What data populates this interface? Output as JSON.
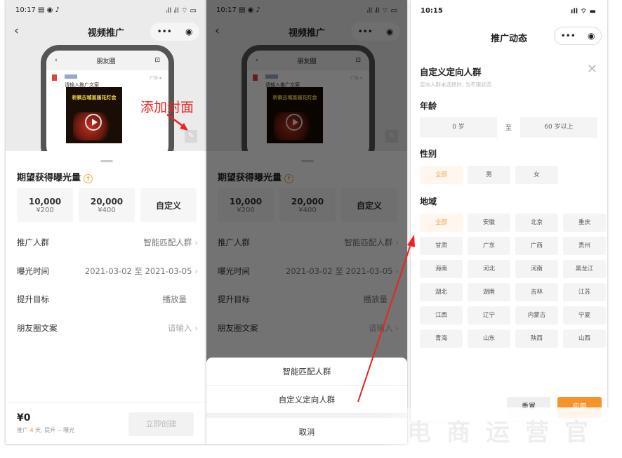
{
  "panel1": {
    "status_time": "10:17",
    "status_icons": "▤ ◉ ♪",
    "status_right": "ᵢll ᵢll ⌔ ▭",
    "nav_title": "视频推广",
    "back_icon": "‹",
    "more_icon": "•••",
    "record_icon": "◉",
    "preview": {
      "title": "朋友圈",
      "camera_icon": "⊡",
      "ad_tag": "广告 ▾",
      "caption": "请输入推广文案",
      "video_title": "析枫古城首届花灯会"
    },
    "annotation": "添加封面",
    "edit_icon": "✎",
    "section_title": "期望获得曝光量",
    "info_icon": "↑",
    "options": [
      {
        "count": "10,000",
        "price": "¥200"
      },
      {
        "count": "20,000",
        "price": "¥400"
      }
    ],
    "custom_label": "自定义",
    "rows": [
      {
        "label": "推广人群",
        "value": "智能匹配人群",
        "chevron": true
      },
      {
        "label": "曝光时间",
        "value": "2021-03-02 至 2021-03-05",
        "chevron": true
      },
      {
        "label": "提升目标",
        "value": "播放量",
        "chevron": false
      },
      {
        "label": "朋友圈文案",
        "value": "请输入",
        "chevron": true
      }
    ],
    "chevron": "›",
    "total": "¥0",
    "summary_prefix": "推广 ",
    "summary_days": "4",
    "summary_mid": " 天, 提升 ",
    "summary_lift": "--",
    "summary_suffix": " 曝光",
    "create_label": "立即创建"
  },
  "panel2": {
    "action_sheet": [
      "智能匹配人群",
      "自定义定向人群"
    ],
    "cancel_label": "取消"
  },
  "panel3": {
    "status_time": "10:15",
    "status_right": "ıll ⌔ ▬",
    "nav_title": "推广动态",
    "title": "自定义定向人群",
    "hint": "定向人群未选择时, 为不限状态",
    "close_icon": "✕",
    "age_title": "年龄",
    "age_from": "0 岁",
    "age_sep": "至",
    "age_to": "60 岁以上",
    "gender_title": "性别",
    "genders": [
      "全部",
      "男",
      "女"
    ],
    "gender_selected": 0,
    "region_title": "地域",
    "regions": [
      "全部",
      "安徽",
      "北京",
      "重庆",
      "甘肃",
      "广东",
      "广西",
      "贵州",
      "海南",
      "河北",
      "河南",
      "黑龙江",
      "湖北",
      "湖南",
      "吉林",
      "江苏",
      "江西",
      "辽宁",
      "内蒙古",
      "宁夏",
      "青海",
      "山东",
      "陕西",
      "山西"
    ],
    "region_selected": 0,
    "reset_label": "重置",
    "apply_label": "应用"
  },
  "watermark": "电商运营官",
  "colors": {
    "accent": "#f6932b",
    "annotation": "#ee2222",
    "selected_text": "#f6a353"
  }
}
